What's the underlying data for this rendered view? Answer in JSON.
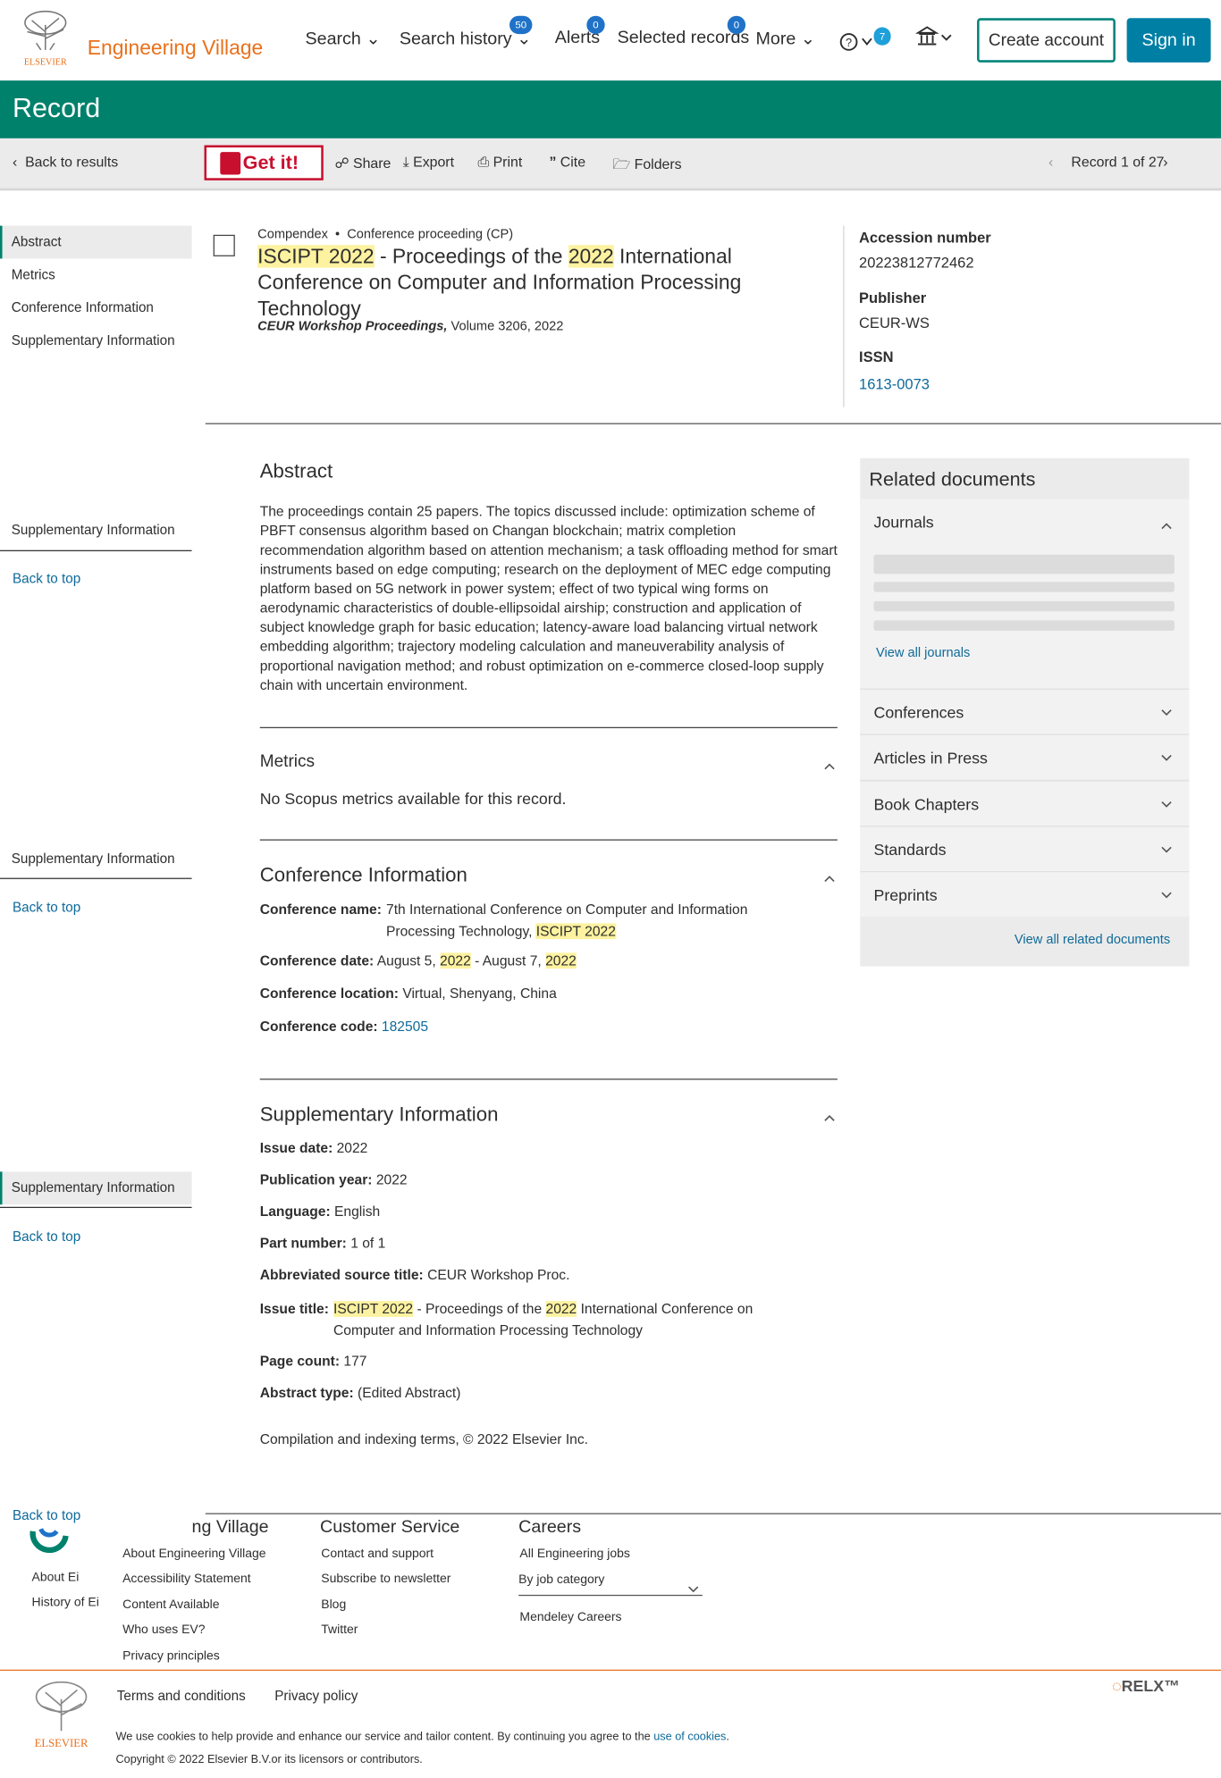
{
  "header": {
    "brand": "Engineering Village",
    "elsevier_word": "ELSEVIER",
    "nav": {
      "search": "Search",
      "search_history": "Search history",
      "search_history_count": "50",
      "alerts": "Alerts",
      "alerts_count": "0",
      "selected": "Selected records",
      "selected_count": "0",
      "more": "More",
      "help_count": "7"
    },
    "create_account": "Create account",
    "sign_in": "Sign in"
  },
  "band": {
    "title": "Record"
  },
  "toolbar": {
    "back": "Back to results",
    "getit": "Get it!",
    "share": "Share",
    "export": "Export",
    "print": "Print",
    "cite": "Cite",
    "folders": "Folders",
    "record_nav": "Record 1 of 27"
  },
  "leftnav": {
    "items": [
      "Abstract",
      "Metrics",
      "Conference Information",
      "Supplementary Information"
    ],
    "supp": "Supplementary Information",
    "back_top": "Back to top"
  },
  "record": {
    "database": "Compendex",
    "doc_type": "Conference proceeding (CP)",
    "title_hl1": "ISCIPT 2022",
    "title_t1": " - Proceedings of the ",
    "title_hl2": "2022",
    "title_t2": " International Conference on Computer and Information Processing Technology",
    "source_name": "CEUR Workshop Proceedings,",
    "source_rest": " Volume 3206, 2022"
  },
  "meta": {
    "acc_label": "Accession number",
    "acc": "20223812772462",
    "pub_label": "Publisher",
    "pub": "CEUR-WS",
    "issn_label": "ISSN",
    "issn": "1613-0073"
  },
  "abstract": {
    "heading": "Abstract",
    "text": "The proceedings contain 25 papers. The topics discussed include: optimization scheme of PBFT consensus algorithm based on Changan blockchain; matrix completion recommendation algorithm based on attention mechanism; a task offloading method for smart instruments based on edge computing; research on the deployment of MEC edge computing platform based on 5G network in power system; effect of two typical wing forms on aerodynamic characteristics of double-ellipsoidal airship; construction and application of subject knowledge graph for basic education; latency-aware load balancing virtual network embedding algorithm; trajectory modeling calculation and maneuverability analysis of proportional navigation method; and robust optimization on e-commerce closed-loop supply chain with uncertain environment."
  },
  "metrics": {
    "heading": "Metrics",
    "text": "No Scopus metrics available for this record."
  },
  "conference": {
    "heading": "Conference Information",
    "name_label": "Conference name:",
    "name_text": "7th International Conference on Computer and Information Processing Technology, ",
    "name_hl": "ISCIPT 2022",
    "date_label": "Conference date:",
    "date_a": "August 5, ",
    "date_hl1": "2022",
    "date_b": " - August 7, ",
    "date_hl2": "2022",
    "loc_label": "Conference location:",
    "loc": "Virtual, Shenyang, China",
    "code_label": "Conference code:",
    "code": "182505"
  },
  "supp": {
    "heading": "Supplementary Information",
    "issue_date_label": "Issue date:",
    "issue_date": "2022",
    "pub_year_label": "Publication year:",
    "pub_year": "2022",
    "lang_label": "Language:",
    "lang": "English",
    "part_label": "Part number:",
    "part": "1 of 1",
    "abbr_label": "Abbreviated source title:",
    "abbr": "CEUR Workshop Proc.",
    "issue_title_label": "Issue title:",
    "it_hl1": "ISCIPT 2022",
    "it_t1": " - Proceedings of the ",
    "it_hl2": "2022",
    "it_t2": " International Conference on Computer and Information Processing Technology",
    "page_count_label": "Page count:",
    "page_count": "177",
    "abs_type_label": "Abstract type:",
    "abs_type": "(Edited Abstract)",
    "copyright": "Compilation and indexing terms, © 2022 Elsevier Inc."
  },
  "related": {
    "heading": "Related documents",
    "journals": "Journals",
    "view_journals": "View all journals",
    "conferences": "Conferences",
    "articles_press": "Articles in Press",
    "book_chapters": "Book Chapters",
    "standards": "Standards",
    "preprints": "Preprints",
    "view_all": "View all related documents"
  },
  "footer": {
    "ev_heading": "ng Village",
    "about_ei": "About Ei",
    "history_ei": "History of Ei",
    "ev_links": [
      "About Engineering Village",
      "Accessibility Statement",
      "Content Available",
      "Who uses EV?",
      "Privacy principles"
    ],
    "cs_heading": "Customer Service",
    "cs_links": [
      "Contact and support",
      "Subscribe to newsletter",
      "Blog",
      "Twitter"
    ],
    "careers_heading": "Careers",
    "careers_all": "All Engineering jobs",
    "careers_select": "By job category",
    "mendeley": "Mendeley Careers",
    "terms": "Terms and conditions",
    "privacy": "Privacy policy",
    "cookie_text": "We use cookies to help provide and enhance our service and tailor content. By continuing you agree to the ",
    "cookie_link": "use of cookies",
    "cookie_end": ".",
    "copyright": "Copyright © 2022 Elsevier B.V.or its licensors or contributors.",
    "relx": "RELX™",
    "elsevier_word": "ELSEVIER"
  },
  "colors": {
    "teal": "#00816c",
    "orange": "#e9711c",
    "link": "#0e6a99",
    "highlight": "#fdf2a0"
  }
}
